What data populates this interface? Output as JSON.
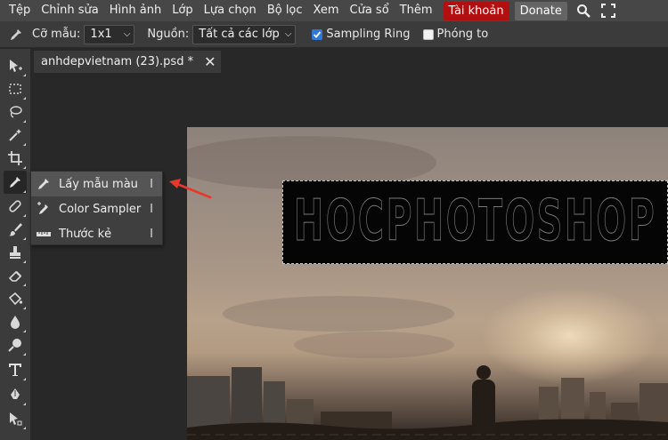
{
  "menubar": {
    "items": [
      "Tệp",
      "Chỉnh sửa",
      "Hình ảnh",
      "Lớp",
      "Lựa chọn",
      "Bộ lọc",
      "Xem",
      "Cửa sổ",
      "Thêm"
    ],
    "account": "Tài khoản",
    "donate": "Donate",
    "search_icon": "search-icon",
    "fullscreen_icon": "fullscreen-icon"
  },
  "options": {
    "sample_size_label": "Cỡ mẫu:",
    "sample_size_value": "1x1",
    "source_label": "Nguồn:",
    "source_value": "Tất cả các lớp",
    "sampling_ring_label": "Sampling Ring",
    "sampling_ring_checked": true,
    "zoom_label": "Phóng to",
    "zoom_checked": false
  },
  "document": {
    "tab_title": "anhdepvietnam (23).psd *",
    "selection_text": "HOCPHOTOSHOP"
  },
  "flyout": {
    "items": [
      {
        "label": "Lấy mẫu màu",
        "shortcut": "I",
        "icon": "eyedropper-icon"
      },
      {
        "label": "Color Sampler",
        "shortcut": "I",
        "icon": "color-sampler-icon"
      },
      {
        "label": "Thước kẻ",
        "shortcut": "I",
        "icon": "ruler-icon"
      }
    ]
  },
  "colors": {
    "menubar_bg": "#474747",
    "account_bg": "#b21010",
    "checkbox_accent": "#2f78d8",
    "annotation_arrow": "#e8382c"
  }
}
